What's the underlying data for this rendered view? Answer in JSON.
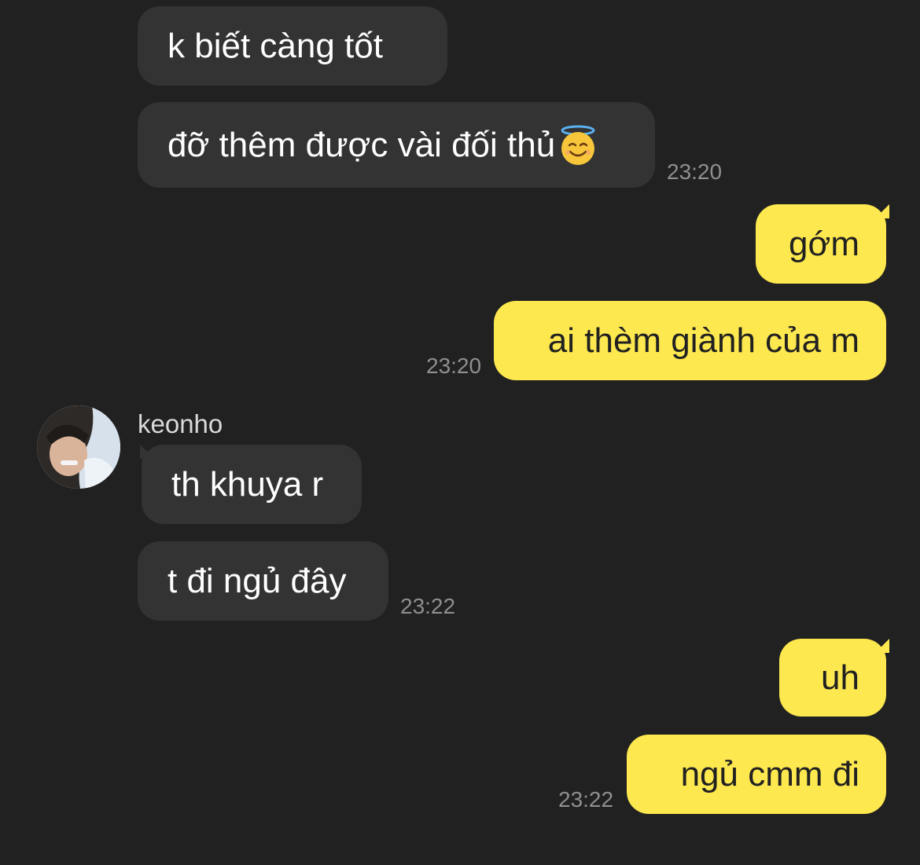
{
  "colors": {
    "background": "#212121",
    "incoming_bubble": "#333333",
    "outgoing_bubble": "#fde84f",
    "timestamp": "#8f8f8f"
  },
  "messages": [
    {
      "side": "in",
      "text": "k biết càng tốt"
    },
    {
      "side": "in",
      "text": "đỡ thêm được vài đối thủ",
      "emoji": "smiling-face-with-halo",
      "time": "23:20"
    },
    {
      "side": "out",
      "text": "gớm"
    },
    {
      "side": "out",
      "text": "ai thèm giành của m",
      "time": "23:20"
    },
    {
      "side": "in",
      "sender": "keonho",
      "text": "th khuya r"
    },
    {
      "side": "in",
      "text": "t đi ngủ đây",
      "time": "23:22"
    },
    {
      "side": "out",
      "text": "uh"
    },
    {
      "side": "out",
      "text": "ngủ cmm đi",
      "time": "23:22"
    }
  ]
}
